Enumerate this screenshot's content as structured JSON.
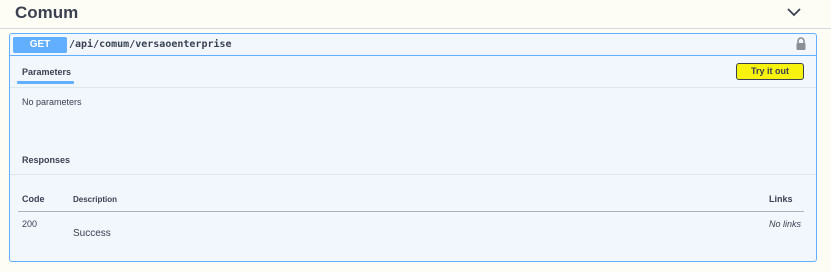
{
  "section": {
    "title": "Comum"
  },
  "operation": {
    "method": "GET",
    "path": "/api/comum/versaoenterprise",
    "method_color": "#61affe"
  },
  "parameters": {
    "tab_label": "Parameters",
    "try_label": "Try it out",
    "try_color": "#f7f30f",
    "empty_text": "No parameters"
  },
  "responses": {
    "title": "Responses",
    "headers": {
      "code": "Code",
      "description": "Description",
      "links": "Links"
    },
    "rows": [
      {
        "code": "200",
        "description": "Success",
        "links": "No links"
      }
    ]
  },
  "icons": {
    "toggle": "chevron-down-icon",
    "lock": "lock-icon"
  }
}
